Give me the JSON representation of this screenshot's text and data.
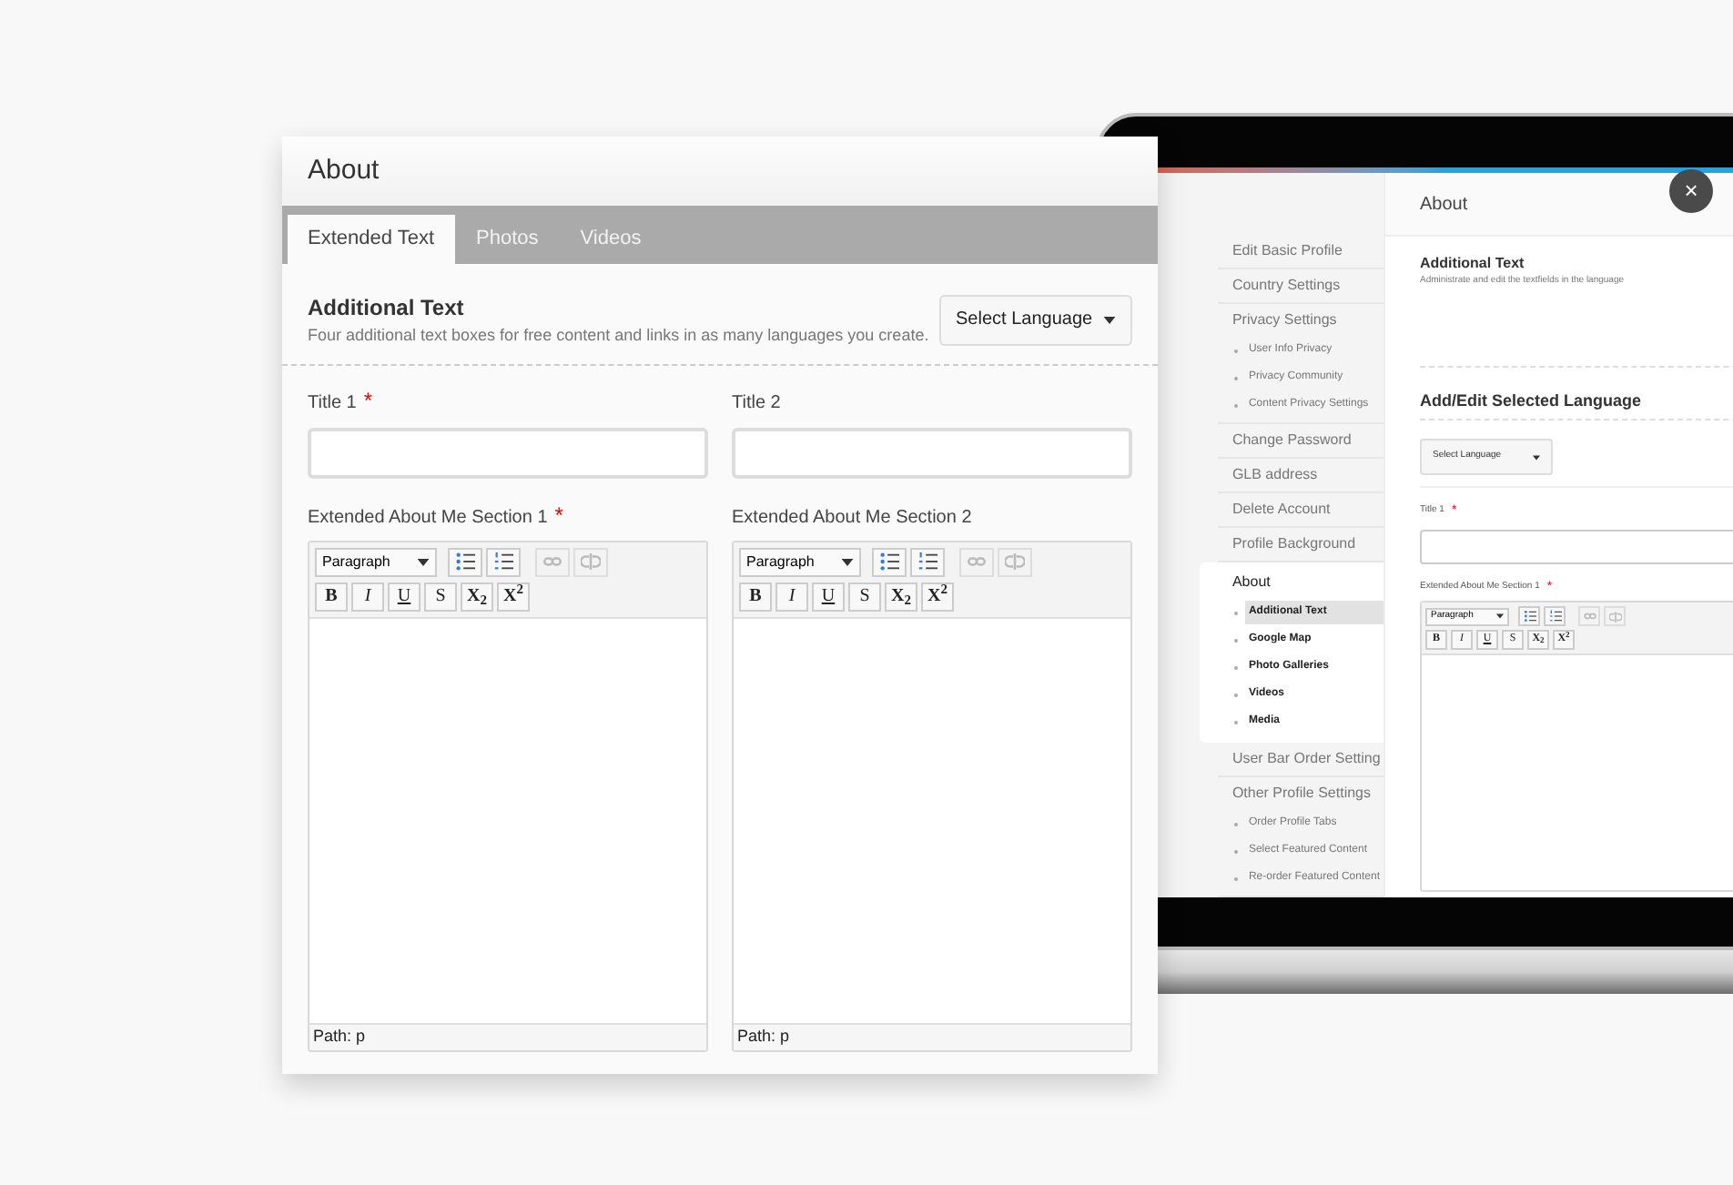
{
  "panel": {
    "title": "About",
    "tabs": [
      {
        "label": "Extended Text",
        "selected": true
      },
      {
        "label": "Photos",
        "selected": false
      },
      {
        "label": "Videos",
        "selected": false
      }
    ],
    "section": {
      "title": "Additional Text",
      "description": "Four additional text boxes for free content and links in as many languages you create."
    },
    "language_select": "Select Language",
    "title_fields": [
      {
        "label": "Title 1",
        "marker": "*"
      },
      {
        "label": "Title 2"
      }
    ],
    "editors": [
      {
        "label": "Extended About Me Section 1",
        "marker": "*",
        "format": "Paragraph",
        "path": "Path: p",
        "buttons": [
          {
            "kind": "bold",
            "label": "B"
          },
          {
            "kind": "italic",
            "label": "I"
          },
          {
            "kind": "underline",
            "label": "U"
          },
          {
            "kind": "strike",
            "label": "S"
          },
          {
            "kind": "sub",
            "label": "X$_{2}$"
          },
          {
            "kind": "sup",
            "label": "X$^{2}$"
          }
        ]
      },
      {
        "label": "Extended About Me Section 2",
        "format": "Paragraph",
        "path": "Path: p",
        "buttons": [
          {
            "kind": "bold",
            "label": "B"
          },
          {
            "kind": "italic",
            "label": "I"
          },
          {
            "kind": "underline",
            "label": "U"
          },
          {
            "kind": "strike",
            "label": "S"
          },
          {
            "kind": "sub",
            "label": "X$_{2}$"
          },
          {
            "kind": "sup",
            "label": "X$^{2}$"
          }
        ]
      }
    ]
  },
  "laptop": {
    "close": "×",
    "sidebar": [
      {
        "label": "Edit Basic Profile",
        "selected": false
      },
      {
        "label": "Country Settings",
        "selected": false
      },
      {
        "label": "Privacy Settings",
        "selected": false,
        "children": [
          {
            "label": "User Info Privacy",
            "selected": false
          },
          {
            "label": "Privacy Community",
            "selected": false
          },
          {
            "label": "Content Privacy Settings",
            "selected": false
          }
        ]
      },
      {
        "label": "Change Password",
        "selected": false
      },
      {
        "label": "GLB address",
        "selected": false
      },
      {
        "label": "Delete Account",
        "selected": false
      },
      {
        "label": "Profile Background",
        "selected": false
      },
      {
        "label": "About",
        "selected": true,
        "children": [
          {
            "label": "Additional Text",
            "selected": true
          },
          {
            "label": "Google Map",
            "selected": false
          },
          {
            "label": "Photo Galleries",
            "selected": false
          },
          {
            "label": "Videos",
            "selected": false
          },
          {
            "label": "Media",
            "selected": false
          }
        ]
      },
      {
        "label": "User Bar Order Setting",
        "selected": false
      },
      {
        "label": "Other Profile Settings",
        "selected": false,
        "children": [
          {
            "label": "Order Profile Tabs",
            "selected": false
          },
          {
            "label": "Select Featured Content",
            "selected": false
          },
          {
            "label": "Re-order Featured Content",
            "selected": false
          }
        ]
      }
    ],
    "pane": {
      "title": "About",
      "section_title": "Additional Text",
      "section_description": "Administrate and edit the textfields in the language",
      "subheading": "Add/Edit Selected Language",
      "language_select": "Select Language",
      "field": {
        "label": "Title 1",
        "marker": "*"
      },
      "editor": {
        "label": "Extended About Me Section 1",
        "marker": "*",
        "format": "Paragraph",
        "buttons": [
          {
            "kind": "bold",
            "label": "B"
          },
          {
            "kind": "italic",
            "label": "I"
          },
          {
            "kind": "underline",
            "label": "U"
          },
          {
            "kind": "strike",
            "label": "S"
          },
          {
            "kind": "sub",
            "label": "X$_{2}$"
          },
          {
            "kind": "sup",
            "label": "X$^{2}$"
          }
        ]
      }
    }
  }
}
